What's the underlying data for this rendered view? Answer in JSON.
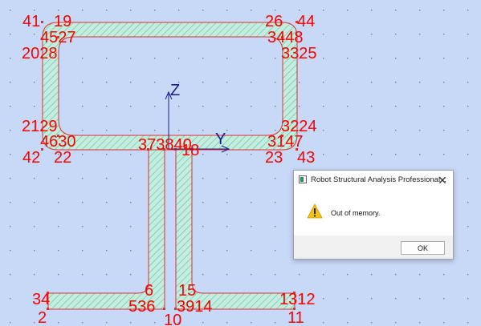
{
  "node_labels": {
    "n41": "41",
    "n19": "19",
    "n26": "26",
    "n44": "44",
    "n45_27": "4527",
    "n34_48": "3448",
    "n20_28": "2028",
    "n33_25": "3325",
    "n21_29": "2129",
    "n32_24": "3224",
    "n46_30": "4630",
    "n31_47": "3147",
    "n42": "42",
    "n22": "22",
    "n23": "23",
    "n43": "43",
    "n37_38_40": "373840",
    "n18": "18",
    "n6": "6",
    "n15": "15",
    "n3_4": "34",
    "n5_36": "536",
    "n39_14": "3914",
    "n13_12": "1312",
    "n2": "2",
    "n10": "10",
    "n11": "11"
  },
  "axes": {
    "z_label": "Z",
    "y_label": "Y"
  },
  "dialog": {
    "title": "Robot Structural Analysis Professional...",
    "close_symbol": "✕",
    "message": "Out of memory.",
    "ok_label": "OK"
  },
  "colors": {
    "background": "#c8d9f7",
    "section_fill": "#c4ecdf",
    "section_outline": "#e03030",
    "node_label": "#ff0000",
    "axis": "#1a1a8c"
  }
}
